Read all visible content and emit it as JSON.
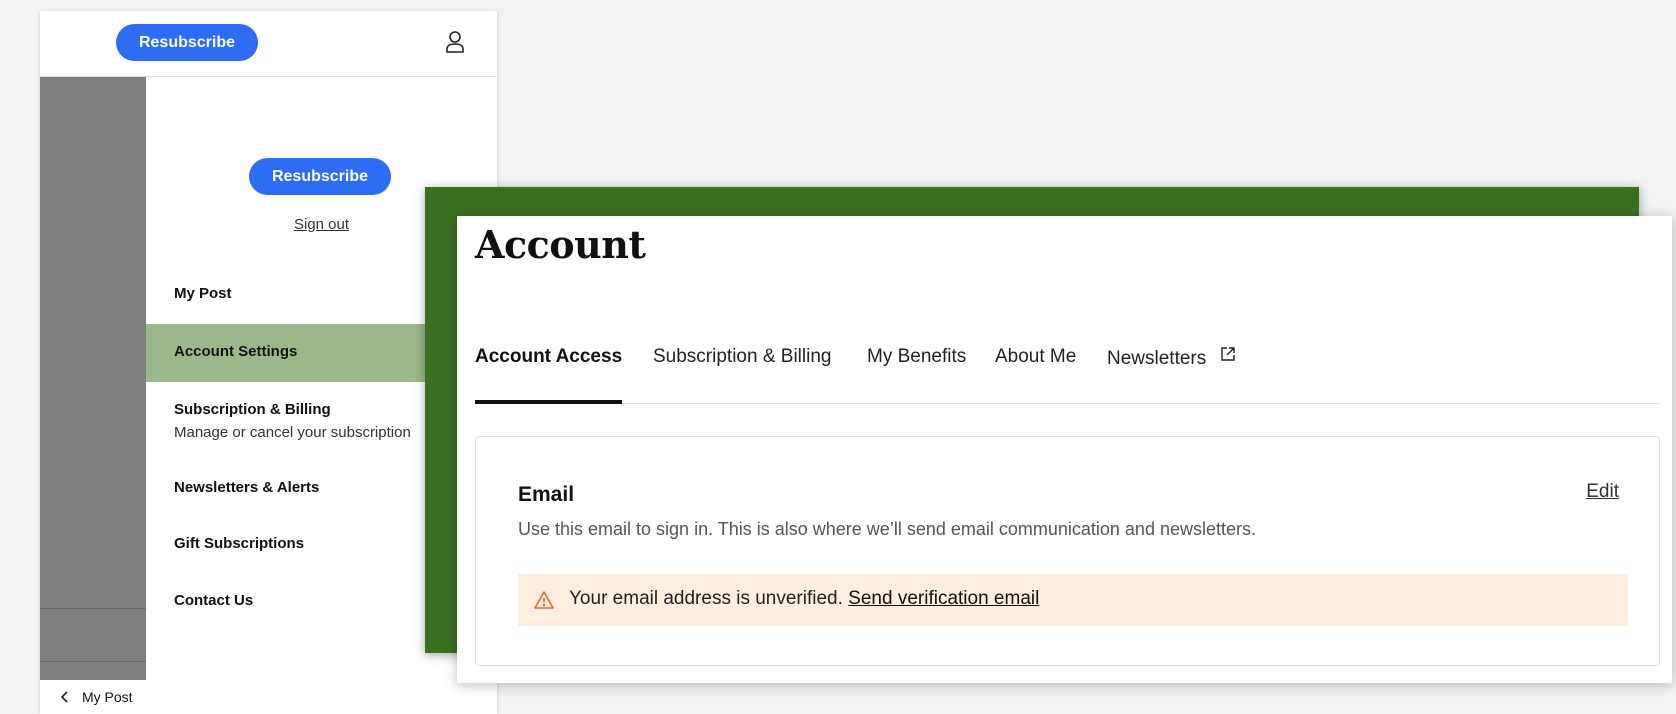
{
  "phone": {
    "top_resubscribe_label": "Resubscribe",
    "user_icon": "user-icon",
    "drawer": {
      "resubscribe_label": "Resubscribe",
      "sign_out_label": "Sign out",
      "menu": [
        {
          "label": "My Post",
          "sub": ""
        },
        {
          "label": "Account Settings",
          "sub": "",
          "active": true
        },
        {
          "label": "Subscription & Billing",
          "sub": "Manage or cancel your subscription"
        },
        {
          "label": "Newsletters & Alerts",
          "sub": ""
        },
        {
          "label": "Gift Subscriptions",
          "sub": ""
        },
        {
          "label": "Contact Us",
          "sub": ""
        }
      ]
    },
    "bottom": {
      "back_icon": "chevron-left-icon",
      "back_label": "My Post"
    }
  },
  "account": {
    "title": "Account",
    "tabs": [
      {
        "label": "Account Access",
        "active": true
      },
      {
        "label": "Subscription & Billing"
      },
      {
        "label": "My Benefits"
      },
      {
        "label": "About Me"
      },
      {
        "label": "Newsletters",
        "icon": "external-link-icon"
      }
    ],
    "email": {
      "heading": "Email",
      "edit_label": "Edit",
      "description": "Use this email to sign in. This is also where we’ll send email communication and newsletters.",
      "warning": {
        "icon": "warning-icon",
        "text": "Your email address is unverified.",
        "link_label": "Send verification email"
      }
    }
  },
  "colors": {
    "accent_blue": "#2e6cf5",
    "active_menu_green": "#9ab98a",
    "banner_green": "#3a6f1f",
    "warning_bg": "#fdeee2"
  }
}
